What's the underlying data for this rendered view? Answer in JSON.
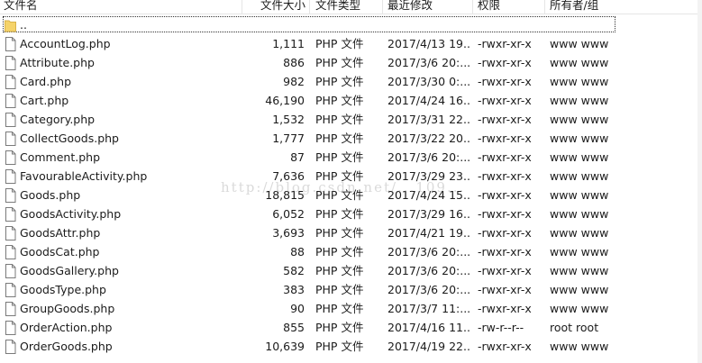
{
  "columns": {
    "name": "文件名",
    "size": "文件大小",
    "type": "文件类型",
    "modified": "最近修改",
    "permissions": "权限",
    "owner": "所有者/组"
  },
  "parent_dir": "..",
  "files": [
    {
      "name": "AccountLog.php",
      "size": "1,111",
      "type": "PHP 文件",
      "modified": "2017/4/13 19...",
      "permissions": "-rwxr-xr-x",
      "owner": "www www"
    },
    {
      "name": "Attribute.php",
      "size": "886",
      "type": "PHP 文件",
      "modified": "2017/3/6 20:...",
      "permissions": "-rwxr-xr-x",
      "owner": "www www"
    },
    {
      "name": "Card.php",
      "size": "982",
      "type": "PHP 文件",
      "modified": "2017/3/30 0:...",
      "permissions": "-rwxr-xr-x",
      "owner": "www www"
    },
    {
      "name": "Cart.php",
      "size": "46,190",
      "type": "PHP 文件",
      "modified": "2017/4/24 16...",
      "permissions": "-rwxr-xr-x",
      "owner": "www www"
    },
    {
      "name": "Category.php",
      "size": "1,532",
      "type": "PHP 文件",
      "modified": "2017/3/31 22...",
      "permissions": "-rwxr-xr-x",
      "owner": "www www"
    },
    {
      "name": "CollectGoods.php",
      "size": "1,777",
      "type": "PHP 文件",
      "modified": "2017/3/22 20...",
      "permissions": "-rwxr-xr-x",
      "owner": "www www"
    },
    {
      "name": "Comment.php",
      "size": "87",
      "type": "PHP 文件",
      "modified": "2017/3/6 20:...",
      "permissions": "-rwxr-xr-x",
      "owner": "www www"
    },
    {
      "name": "FavourableActivity.php",
      "size": "7,636",
      "type": "PHP 文件",
      "modified": "2017/3/29 23...",
      "permissions": "-rwxr-xr-x",
      "owner": "www www"
    },
    {
      "name": "Goods.php",
      "size": "18,815",
      "type": "PHP 文件",
      "modified": "2017/4/24 15...",
      "permissions": "-rwxr-xr-x",
      "owner": "www www"
    },
    {
      "name": "GoodsActivity.php",
      "size": "6,052",
      "type": "PHP 文件",
      "modified": "2017/3/29 16...",
      "permissions": "-rwxr-xr-x",
      "owner": "www www"
    },
    {
      "name": "GoodsAttr.php",
      "size": "3,693",
      "type": "PHP 文件",
      "modified": "2017/4/21 19...",
      "permissions": "-rwxr-xr-x",
      "owner": "www www"
    },
    {
      "name": "GoodsCat.php",
      "size": "88",
      "type": "PHP 文件",
      "modified": "2017/3/6 20:...",
      "permissions": "-rwxr-xr-x",
      "owner": "www www"
    },
    {
      "name": "GoodsGallery.php",
      "size": "582",
      "type": "PHP 文件",
      "modified": "2017/3/6 20:...",
      "permissions": "-rwxr-xr-x",
      "owner": "www www"
    },
    {
      "name": "GoodsType.php",
      "size": "383",
      "type": "PHP 文件",
      "modified": "2017/3/6 20:...",
      "permissions": "-rwxr-xr-x",
      "owner": "www www"
    },
    {
      "name": "GroupGoods.php",
      "size": "90",
      "type": "PHP 文件",
      "modified": "2017/3/7 11:...",
      "permissions": "-rwxr-xr-x",
      "owner": "www www"
    },
    {
      "name": "OrderAction.php",
      "size": "855",
      "type": "PHP 文件",
      "modified": "2017/4/16 11...",
      "permissions": "-rw-r--r--",
      "owner": "root root"
    },
    {
      "name": "OrderGoods.php",
      "size": "10,639",
      "type": "PHP 文件",
      "modified": "2017/4/19 22...",
      "permissions": "-rwxr-xr-x",
      "owner": "www www"
    }
  ],
  "watermark": "http://blog.csdn.net/...109...",
  "colors": {
    "folder": "#f5d36a",
    "folder_edge": "#d8b24a",
    "file_outline": "#7a7a7a",
    "header_separator": "#e5e5e5"
  }
}
